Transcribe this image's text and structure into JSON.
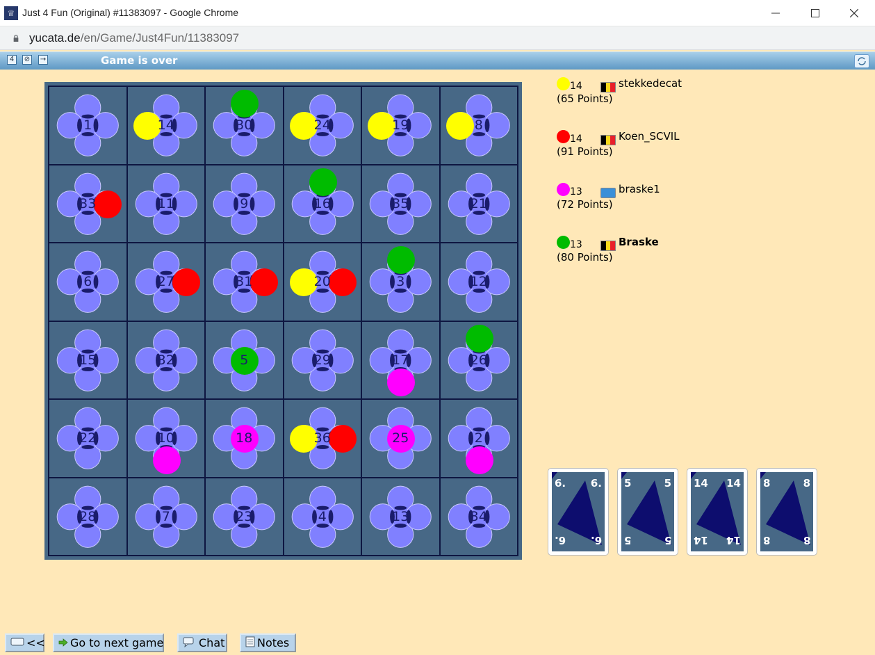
{
  "window": {
    "title": "Just 4 Fun (Original) #11383097 - Google Chrome",
    "url_host": "yucata.de",
    "url_path": "/en/Game/Just4Fun/11383097"
  },
  "toolbar": {
    "status": "Game is over",
    "icons": [
      "board-size-icon",
      "toggle-icon",
      "move-icon",
      "refresh-icon"
    ]
  },
  "colors": {
    "yellow": "#ffff00",
    "red": "#ff0000",
    "magenta": "#ff00ff",
    "green": "#00bb00",
    "petal": "#8080ff",
    "cell": "#476886",
    "card_triangle": "#0d0d6e"
  },
  "board": {
    "rows": [
      [
        {
          "n": "1",
          "pawns": []
        },
        {
          "n": "14",
          "pawns": [
            {
              "c": "yellow",
              "pos": "left"
            }
          ]
        },
        {
          "n": "30",
          "pawns": [
            {
              "c": "green",
              "pos": "top"
            }
          ]
        },
        {
          "n": "24",
          "pawns": [
            {
              "c": "yellow",
              "pos": "left"
            }
          ]
        },
        {
          "n": "19",
          "pawns": [
            {
              "c": "yellow",
              "pos": "left"
            }
          ]
        },
        {
          "n": "8",
          "pawns": [
            {
              "c": "yellow",
              "pos": "left"
            }
          ]
        }
      ],
      [
        {
          "n": "33",
          "pawns": [
            {
              "c": "red",
              "pos": "right"
            }
          ]
        },
        {
          "n": "11",
          "pawns": []
        },
        {
          "n": "9",
          "pawns": []
        },
        {
          "n": "16",
          "pawns": [
            {
              "c": "green",
              "pos": "top"
            }
          ]
        },
        {
          "n": "35",
          "pawns": []
        },
        {
          "n": "21",
          "pawns": []
        }
      ],
      [
        {
          "n": "6",
          "pawns": []
        },
        {
          "n": "27",
          "pawns": [
            {
              "c": "red",
              "pos": "right"
            }
          ]
        },
        {
          "n": "31",
          "pawns": [
            {
              "c": "red",
              "pos": "right"
            }
          ]
        },
        {
          "n": "20",
          "pawns": [
            {
              "c": "yellow",
              "pos": "left"
            },
            {
              "c": "red",
              "pos": "right"
            }
          ]
        },
        {
          "n": "3",
          "pawns": [
            {
              "c": "green",
              "pos": "top"
            }
          ]
        },
        {
          "n": "12",
          "pawns": []
        }
      ],
      [
        {
          "n": "15",
          "pawns": []
        },
        {
          "n": "32",
          "pawns": []
        },
        {
          "n": "5",
          "pawns": [
            {
              "c": "green",
              "pos": "center"
            }
          ]
        },
        {
          "n": "29",
          "pawns": []
        },
        {
          "n": "17",
          "pawns": [
            {
              "c": "magenta",
              "pos": "bottom"
            }
          ]
        },
        {
          "n": "26",
          "pawns": [
            {
              "c": "green",
              "pos": "top"
            }
          ]
        }
      ],
      [
        {
          "n": "22",
          "pawns": []
        },
        {
          "n": "10",
          "pawns": [
            {
              "c": "magenta",
              "pos": "bottom"
            }
          ]
        },
        {
          "n": "18",
          "pawns": [
            {
              "c": "magenta",
              "pos": "center"
            }
          ]
        },
        {
          "n": "36",
          "pawns": [
            {
              "c": "yellow",
              "pos": "left"
            },
            {
              "c": "red",
              "pos": "right"
            }
          ]
        },
        {
          "n": "25",
          "pawns": [
            {
              "c": "magenta",
              "pos": "center"
            }
          ]
        },
        {
          "n": "2",
          "pawns": [
            {
              "c": "magenta",
              "pos": "bottom"
            }
          ]
        }
      ],
      [
        {
          "n": "28",
          "pawns": []
        },
        {
          "n": "7",
          "pawns": []
        },
        {
          "n": "23",
          "pawns": []
        },
        {
          "n": "4",
          "pawns": []
        },
        {
          "n": "13",
          "pawns": []
        },
        {
          "n": "34",
          "pawns": []
        }
      ]
    ]
  },
  "players": [
    {
      "color": "yellow",
      "count": "14",
      "flag": "be",
      "name": "stekkedecat",
      "points": "(65 Points)",
      "bold": false
    },
    {
      "color": "red",
      "count": "14",
      "flag": "be",
      "name": "Koen_SCVIL",
      "points": "(91 Points)",
      "bold": false
    },
    {
      "color": "magenta",
      "count": "13",
      "flag": "un",
      "name": "braske1",
      "points": "(72 Points)",
      "bold": false
    },
    {
      "color": "green",
      "count": "13",
      "flag": "be",
      "name": "Braske",
      "points": "(80 Points)",
      "bold": true
    }
  ],
  "cards": [
    {
      "value": "6."
    },
    {
      "value": "5"
    },
    {
      "value": "14"
    },
    {
      "value": "8"
    }
  ],
  "buttons": {
    "back": "<<",
    "next_game": "Go to next game",
    "chat": "Chat",
    "notes": "Notes"
  }
}
